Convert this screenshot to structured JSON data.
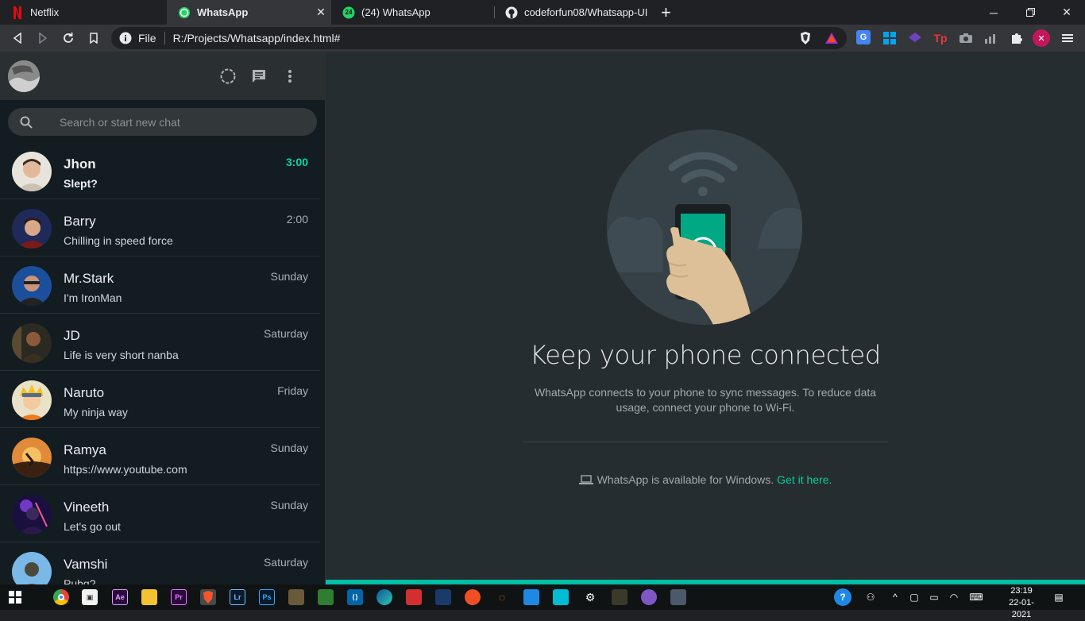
{
  "browser": {
    "tabs": [
      {
        "title": "Netflix",
        "icon": "netflix-icon",
        "active": false
      },
      {
        "title": "WhatsApp",
        "icon": "whatsapp-icon",
        "active": true
      },
      {
        "title": "(24) WhatsApp",
        "icon": "whatsapp-badge-icon",
        "badge": "24",
        "active": false
      },
      {
        "title": "codeforfun08/Whatsapp-UI",
        "icon": "github-icon",
        "active": false
      }
    ],
    "new_tab": "+",
    "address": {
      "scheme_label": "File",
      "url": "R:/Projects/Whatsapp/index.html#"
    }
  },
  "app": {
    "search": {
      "placeholder": "Search or start new chat"
    },
    "chats": [
      {
        "name": "Jhon",
        "message": "Slept?",
        "time": "3:00",
        "unread": true
      },
      {
        "name": "Barry",
        "message": "Chilling in speed force",
        "time": "2:00",
        "unread": false
      },
      {
        "name": "Mr.Stark",
        "message": "I'm IronMan",
        "time": "Sunday",
        "unread": false
      },
      {
        "name": "JD",
        "message": "Life is very short nanba",
        "time": "Saturday",
        "unread": false
      },
      {
        "name": "Naruto",
        "message": "My ninja way",
        "time": "Friday",
        "unread": false
      },
      {
        "name": "Ramya",
        "message": "https://www.youtube.com",
        "time": "Sunday",
        "unread": false
      },
      {
        "name": "Vineeth",
        "message": "Let's go out",
        "time": "Sunday",
        "unread": false
      },
      {
        "name": "Vamshi",
        "message": "Pubg?",
        "time": "Saturday",
        "unread": false
      }
    ],
    "intro": {
      "title": "Keep your phone connected",
      "description": "WhatsApp connects to your phone to sync messages. To reduce data usage, connect your phone to Wi-Fi.",
      "windows_text": "WhatsApp is available for Windows.",
      "windows_link": "Get it here."
    },
    "colors": {
      "accent": "#00bfa5",
      "link": "#06cf9c",
      "sidebar": "#131c21",
      "header": "#2a2f32"
    }
  },
  "taskbar": {
    "clock_time": "23:19",
    "clock_date": "22-01-2021"
  }
}
